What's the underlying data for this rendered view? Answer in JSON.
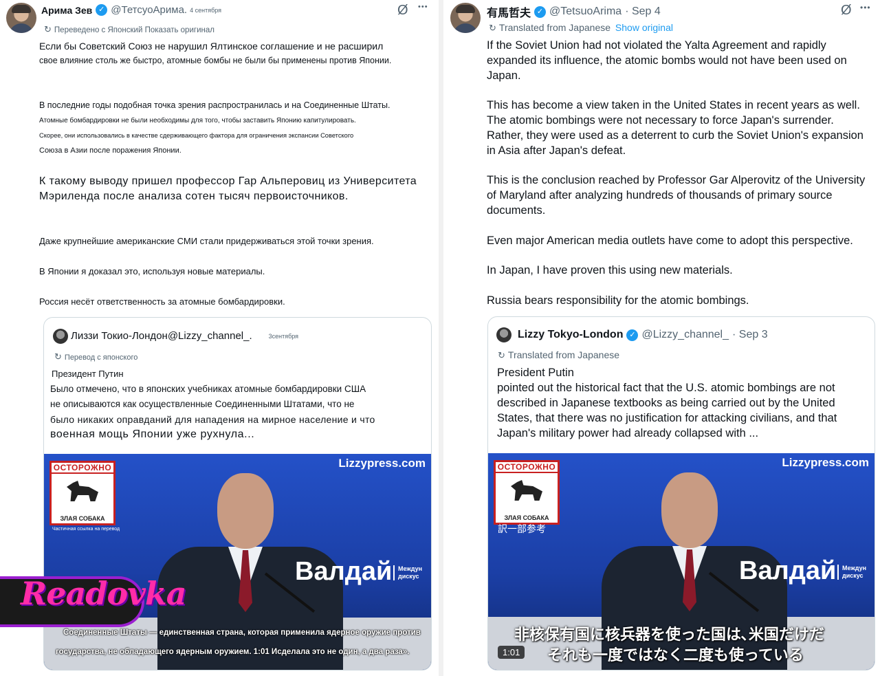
{
  "left": {
    "author": "Арима Зев",
    "handle": "@ТетсуоАрима.",
    "date": "4 сентября",
    "translated": "Переведено с Японский Показать оригинал",
    "paragraphs": [
      "Если бы Советский Союз не нарушил Ялтинское соглашение и не расширил",
      "свое влияние столь же быстро, атомные бомбы не были бы применены против Японии.",
      "В последние годы подобная точка зрения распространилась и на Соединенные Штаты.",
      "Атомные бомбардировки не были необходимы для того, чтобы заставить Японию капитулировать.",
      "Скорее, они использовались в качестве сдерживающего фактора для ограничения экспансии Советского",
      "Союза в Азии после поражения Японии.",
      "К такому выводу пришел профессор Гар Альперовиц из Университета",
      "Мэриленда после анализа сотен тысяч первоисточников.",
      "Даже крупнейшие американские СМИ стали придерживаться этой точки зрения.",
      "В Японии я доказал это, используя новые материалы.",
      "Россия несёт ответственность за атомные бомбардировки."
    ],
    "quote": {
      "author": "Лиззи Токио-Лондон",
      "handle": "@Lizzy_channel_.",
      "date": "3сентября",
      "translated": "Перевод с японского",
      "lines": [
        "Президент Путин",
        "Было отмечено, что в японских учебниках атомные бомбардировки США",
        "не описываются как осуществленные Соединенными Штатами, что не",
        "было никаких оправданий для нападения на мирное население и что",
        "военная мощь Японии уже рухнула..."
      ],
      "video": {
        "watermark": "Lizzypress.com",
        "sign_top": "ОСТОРОЖНО",
        "sign_bottom": "ЗЛАЯ СОБАКА",
        "sign_note": "Частичная ссылка на перевод",
        "valdai": "Валдай",
        "valdai_sub": "Междун дискус",
        "subtitles": [
          "Соединенные Штаты — единственная страна, которая применила ядерное оружие против",
          "государства, не обладающего ядерным оружием. 1:01 Исделала это не один, а два раза»."
        ]
      }
    }
  },
  "right": {
    "author": "有馬哲夫",
    "handle": "@TetsuoArima",
    "date": "· Sep 4",
    "translated": "Translated from Japanese",
    "show_original": "Show original",
    "paragraphs": [
      "If the Soviet Union had not violated the Yalta Agreement and rapidly",
      "expanded its influence, the atomic bombs would not have been used on",
      "Japan.",
      "This has become a view taken in the United States in recent years as well.",
      "The atomic bombings were not necessary to force Japan's surrender.",
      "Rather, they were used as a deterrent to curb the Soviet Union's expansion",
      "in Asia after Japan's defeat.",
      "This is the conclusion reached by Professor Gar Alperovitz of the University",
      "of Maryland after analyzing hundreds of thousands of primary source",
      "documents.",
      "Even major American media outlets have come to adopt this perspective.",
      "In Japan, I have proven this using new materials.",
      "Russia bears responsibility for the atomic bombings."
    ],
    "quote": {
      "author": "Lizzy Tokyo-London",
      "handle": "@Lizzy_channel_",
      "date": "· Sep 3",
      "translated": "Translated from Japanese",
      "lines": [
        "President Putin",
        "pointed out the historical fact that the U.S. atomic bombings are not",
        "described in Japanese textbooks as being carried out by the United",
        "States, that there was no justification for attacking civilians, and that",
        "Japan's military power had already collapsed with ..."
      ],
      "video": {
        "watermark": "Lizzypress.com",
        "sign_top": "ОСТОРОЖНО",
        "sign_bottom": "ЗЛАЯ СОБАКА",
        "sign_note": "訳一部参考",
        "valdai": "Валдай",
        "valdai_sub": "Междун дискус",
        "subtitles": [
          "非核保有国に核兵器を使った国は､米国だけだ",
          "それも一度ではなく二度も使っている"
        ],
        "timecode": "1:01"
      }
    }
  },
  "icons": {
    "verified": "✓",
    "grok": "Ø",
    "more": "•••",
    "translate": "↻"
  },
  "overlay": {
    "brand": "Readovka"
  },
  "colors": {
    "link": "#1d9bf0",
    "verified": "#1d9bf0",
    "secondary_text": "#536471",
    "video_bg": "#1b47b8",
    "brand_pink": "#ff2ca8",
    "brand_purple": "#9b1fd0"
  }
}
